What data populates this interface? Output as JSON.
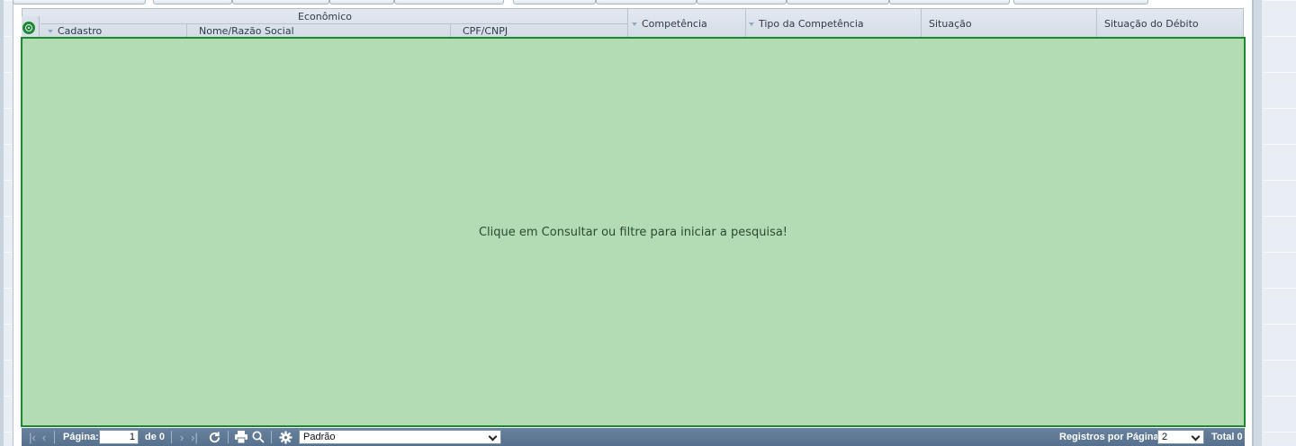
{
  "grid": {
    "group_header": "Econômico",
    "columns": {
      "cadastro": "Cadastro",
      "nome": "Nome/Razão Social",
      "cpf_cnpj": "CPF/CNPJ",
      "competencia": "Competência",
      "tipo_competencia": "Tipo da Competência",
      "situacao": "Situação",
      "situacao_debito": "Situação do Débito"
    },
    "empty_message": "Clique em Consultar ou filtre para iniciar a pesquisa!"
  },
  "pager": {
    "page_label": "Página:",
    "page_value": "1",
    "of_label": "de 0",
    "layout_value": "Padrão",
    "per_page_label": "Registros por Página:",
    "per_page_value": "2",
    "total_label": "Total 0"
  },
  "icons": {
    "first": "first-page-icon",
    "prev": "prev-page-icon",
    "next": "next-page-icon",
    "last": "last-page-icon",
    "refresh": "refresh-icon",
    "print": "print-icon",
    "search": "search-icon",
    "settings": "gear-icon"
  },
  "colors": {
    "empty_panel_bg": "#b3dcb5",
    "empty_panel_border": "#198a2d",
    "pager_bg": "#5e7894",
    "header_bg": "#dce3eb"
  }
}
